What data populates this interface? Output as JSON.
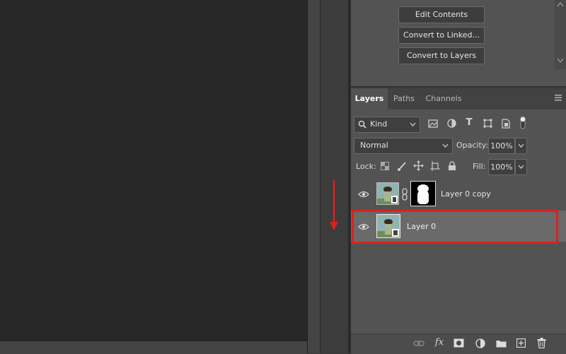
{
  "properties": {
    "buttons": [
      "Edit Contents",
      "Convert to Linked...",
      "Convert to Layers"
    ]
  },
  "layers_panel": {
    "tabs": [
      "Layers",
      "Paths",
      "Channels"
    ],
    "active_tab": "Layers",
    "filter": {
      "label": "Kind"
    },
    "blend_mode": "Normal",
    "opacity_label": "Opacity:",
    "opacity_value": "100%",
    "lock_label": "Lock:",
    "fill_label": "Fill:",
    "fill_value": "100%",
    "layers": [
      {
        "name": "Layer 0 copy",
        "has_mask": true,
        "selected": false,
        "visible": true
      },
      {
        "name": "Layer 0",
        "has_mask": false,
        "selected": true,
        "visible": true
      }
    ]
  },
  "annotation": {
    "highlight_color": "#e01f1f",
    "arrow_direction": "down"
  }
}
